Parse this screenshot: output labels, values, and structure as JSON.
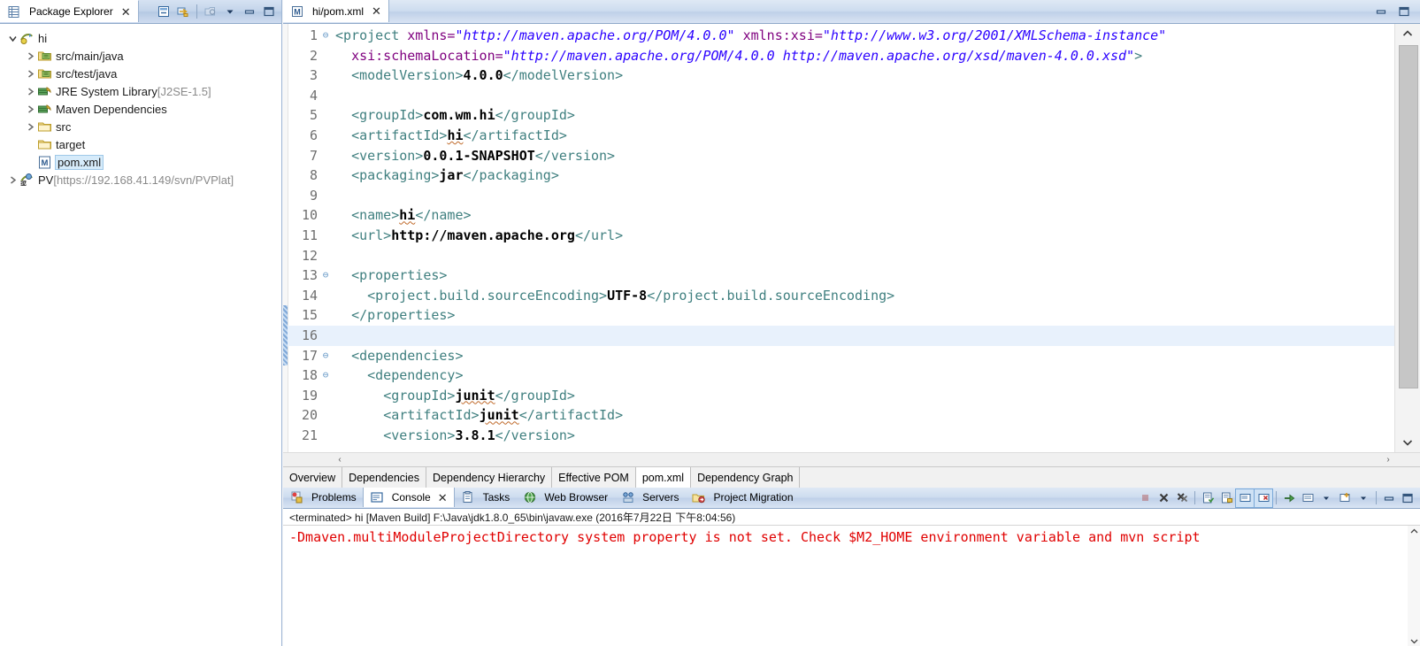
{
  "explorer": {
    "tab_label": "Package Explorer",
    "close_icon": "✕",
    "toolbar": [
      {
        "name": "collapse-all-icon",
        "title": "Collapse All"
      },
      {
        "name": "link-with-editor-icon",
        "title": "Link with Editor"
      },
      {
        "name": "view-menu-focus-icon",
        "title": "Focus On"
      },
      {
        "name": "chevron-down-icon",
        "title": "View Menu"
      },
      {
        "name": "minimize-icon",
        "title": "Minimize"
      },
      {
        "name": "maximize-icon",
        "title": "Maximize"
      }
    ],
    "tree": [
      {
        "label": "hi",
        "indent": 0,
        "icon": "maven-project-icon",
        "twisty": "expanded",
        "selected": false,
        "suffix": ""
      },
      {
        "label": "src/main/java",
        "indent": 1,
        "icon": "source-folder-icon",
        "twisty": "collapsed",
        "selected": false,
        "suffix": ""
      },
      {
        "label": "src/test/java",
        "indent": 1,
        "icon": "source-folder-icon",
        "twisty": "collapsed",
        "selected": false,
        "suffix": ""
      },
      {
        "label": "JRE System Library",
        "indent": 1,
        "icon": "library-icon",
        "twisty": "collapsed",
        "selected": false,
        "suffix": "[J2SE-1.5]"
      },
      {
        "label": "Maven Dependencies",
        "indent": 1,
        "icon": "library-icon",
        "twisty": "collapsed",
        "selected": false,
        "suffix": ""
      },
      {
        "label": "src",
        "indent": 1,
        "icon": "folder-icon",
        "twisty": "collapsed",
        "selected": false,
        "suffix": ""
      },
      {
        "label": "target",
        "indent": 1,
        "icon": "folder-icon",
        "twisty": "none",
        "selected": false,
        "suffix": ""
      },
      {
        "label": "pom.xml",
        "indent": 1,
        "icon": "maven-pom-icon",
        "twisty": "none",
        "selected": true,
        "suffix": ""
      },
      {
        "label": "PV",
        "indent": 0,
        "icon": "svn-project-icon",
        "twisty": "collapsed",
        "selected": false,
        "suffix": "[https://192.168.41.149/svn/PVPlat]"
      }
    ]
  },
  "editor": {
    "tab_label": "hi/pom.xml",
    "tab_icon": "maven-pom-icon",
    "close_icon": "✕",
    "minimize_icon": "minimize",
    "maximize_icon": "maximize",
    "scroll_up_icon": "︿",
    "scroll_down_icon": "﹀",
    "hscroll_left_icon": "‹",
    "hscroll_right_icon": "›",
    "current_line": 16,
    "change_bar_lines": [
      15,
      16,
      17
    ],
    "subtabs": [
      {
        "label": "Overview",
        "active": false
      },
      {
        "label": "Dependencies",
        "active": false
      },
      {
        "label": "Dependency Hierarchy",
        "active": false
      },
      {
        "label": "Effective POM",
        "active": false
      },
      {
        "label": "pom.xml",
        "active": true
      },
      {
        "label": "Dependency Graph",
        "active": false
      }
    ],
    "lines": [
      {
        "n": 1,
        "fold": true,
        "segs": [
          {
            "t": "tag",
            "s": "<project "
          },
          {
            "t": "attr",
            "s": "xmlns="
          },
          {
            "t": "val",
            "s": "\"http://maven.apache.org/POM/4.0.0\""
          },
          {
            "t": "tag",
            "s": " "
          },
          {
            "t": "attr",
            "s": "xmlns:xsi="
          },
          {
            "t": "val",
            "s": "\"http://www.w3.org/2001/XMLSchema-instance\""
          }
        ]
      },
      {
        "n": 2,
        "fold": false,
        "segs": [
          {
            "t": "plain",
            "s": "  "
          },
          {
            "t": "attr",
            "s": "xsi:schemaLocation="
          },
          {
            "t": "val",
            "s": "\"http://maven.apache.org/POM/4.0.0 http://maven.apache.org/xsd/maven-4.0.0.xsd\""
          },
          {
            "t": "tag",
            "s": ">"
          }
        ]
      },
      {
        "n": 3,
        "fold": false,
        "segs": [
          {
            "t": "plain",
            "s": "  "
          },
          {
            "t": "tag",
            "s": "<modelVersion>"
          },
          {
            "t": "txt",
            "s": "4.0.0"
          },
          {
            "t": "tag",
            "s": "</modelVersion>"
          }
        ]
      },
      {
        "n": 4,
        "fold": false,
        "segs": []
      },
      {
        "n": 5,
        "fold": false,
        "segs": [
          {
            "t": "plain",
            "s": "  "
          },
          {
            "t": "tag",
            "s": "<groupId>"
          },
          {
            "t": "txt",
            "s": "com.wm.hi"
          },
          {
            "t": "tag",
            "s": "</groupId>"
          }
        ]
      },
      {
        "n": 6,
        "fold": false,
        "segs": [
          {
            "t": "plain",
            "s": "  "
          },
          {
            "t": "tag",
            "s": "<artifactId>"
          },
          {
            "t": "txtsp",
            "s": "hi"
          },
          {
            "t": "tag",
            "s": "</artifactId>"
          }
        ]
      },
      {
        "n": 7,
        "fold": false,
        "segs": [
          {
            "t": "plain",
            "s": "  "
          },
          {
            "t": "tag",
            "s": "<version>"
          },
          {
            "t": "txt",
            "s": "0.0.1-SNAPSHOT"
          },
          {
            "t": "tag",
            "s": "</version>"
          }
        ]
      },
      {
        "n": 8,
        "fold": false,
        "segs": [
          {
            "t": "plain",
            "s": "  "
          },
          {
            "t": "tag",
            "s": "<packaging>"
          },
          {
            "t": "txt",
            "s": "jar"
          },
          {
            "t": "tag",
            "s": "</packaging>"
          }
        ]
      },
      {
        "n": 9,
        "fold": false,
        "segs": []
      },
      {
        "n": 10,
        "fold": false,
        "segs": [
          {
            "t": "plain",
            "s": "  "
          },
          {
            "t": "tag",
            "s": "<name>"
          },
          {
            "t": "txtsp",
            "s": "hi"
          },
          {
            "t": "tag",
            "s": "</name>"
          }
        ]
      },
      {
        "n": 11,
        "fold": false,
        "segs": [
          {
            "t": "plain",
            "s": "  "
          },
          {
            "t": "tag",
            "s": "<url>"
          },
          {
            "t": "txt",
            "s": "http://maven.apache.org"
          },
          {
            "t": "tag",
            "s": "</url>"
          }
        ]
      },
      {
        "n": 12,
        "fold": false,
        "segs": []
      },
      {
        "n": 13,
        "fold": true,
        "segs": [
          {
            "t": "plain",
            "s": "  "
          },
          {
            "t": "tag",
            "s": "<properties>"
          }
        ]
      },
      {
        "n": 14,
        "fold": false,
        "segs": [
          {
            "t": "plain",
            "s": "    "
          },
          {
            "t": "tag",
            "s": "<project.build.sourceEncoding>"
          },
          {
            "t": "txt",
            "s": "UTF-8"
          },
          {
            "t": "tag",
            "s": "</project.build.sourceEncoding>"
          }
        ]
      },
      {
        "n": 15,
        "fold": false,
        "segs": [
          {
            "t": "plain",
            "s": "  "
          },
          {
            "t": "tag",
            "s": "</properties>"
          }
        ]
      },
      {
        "n": 16,
        "fold": false,
        "segs": []
      },
      {
        "n": 17,
        "fold": true,
        "segs": [
          {
            "t": "plain",
            "s": "  "
          },
          {
            "t": "tag",
            "s": "<dependencies>"
          }
        ]
      },
      {
        "n": 18,
        "fold": true,
        "segs": [
          {
            "t": "plain",
            "s": "    "
          },
          {
            "t": "tag",
            "s": "<dependency>"
          }
        ]
      },
      {
        "n": 19,
        "fold": false,
        "segs": [
          {
            "t": "plain",
            "s": "      "
          },
          {
            "t": "tag",
            "s": "<groupId>"
          },
          {
            "t": "txtsp",
            "s": "junit"
          },
          {
            "t": "tag",
            "s": "</groupId>"
          }
        ]
      },
      {
        "n": 20,
        "fold": false,
        "segs": [
          {
            "t": "plain",
            "s": "      "
          },
          {
            "t": "tag",
            "s": "<artifactId>"
          },
          {
            "t": "txtsp",
            "s": "junit"
          },
          {
            "t": "tag",
            "s": "</artifactId>"
          }
        ]
      },
      {
        "n": 21,
        "fold": false,
        "segs": [
          {
            "t": "plain",
            "s": "      "
          },
          {
            "t": "tag",
            "s": "<version>"
          },
          {
            "t": "txt",
            "s": "3.8.1"
          },
          {
            "t": "tag",
            "s": "</version>"
          }
        ]
      }
    ]
  },
  "console": {
    "tabs": [
      {
        "label": "Problems",
        "icon": "problems-icon",
        "active": false,
        "closable": false
      },
      {
        "label": "Console",
        "icon": "console-icon",
        "active": true,
        "closable": true
      },
      {
        "label": "Tasks",
        "icon": "tasks-icon",
        "active": false,
        "closable": false
      },
      {
        "label": "Web Browser",
        "icon": "web-browser-icon",
        "active": false,
        "closable": false
      },
      {
        "label": "Servers",
        "icon": "servers-icon",
        "active": false,
        "closable": false
      },
      {
        "label": "Project Migration",
        "icon": "project-migration-icon",
        "active": false,
        "closable": false
      }
    ],
    "close_icon": "✕",
    "toolbar": [
      {
        "name": "terminate-icon",
        "title": "Terminate"
      },
      {
        "name": "remove-launch-icon",
        "title": "Remove Launch"
      },
      {
        "name": "remove-all-terminated-icon",
        "title": "Remove All Terminated Launches"
      },
      {
        "name": "clear-console-icon",
        "title": "Clear Console"
      },
      {
        "name": "scroll-lock-icon",
        "title": "Scroll Lock"
      },
      {
        "name": "show-console-icon",
        "title": "Show Console When Output Changes"
      },
      {
        "name": "close-console-icon",
        "title": "Close Console"
      },
      {
        "name": "pin-console-icon",
        "title": "Pin Console"
      },
      {
        "name": "display-selected-console-icon",
        "title": "Display Selected Console"
      },
      {
        "name": "display-console-dropdown-icon",
        "title": "Display Console Menu"
      },
      {
        "name": "open-console-icon",
        "title": "Open Console"
      },
      {
        "name": "open-console-dropdown-icon",
        "title": "Open Console Menu"
      },
      {
        "name": "minimize-icon",
        "title": "Minimize"
      },
      {
        "name": "maximize-icon",
        "title": "Maximize"
      }
    ],
    "status_line": "<terminated> hi [Maven Build] F:\\Java\\jdk1.8.0_65\\bin\\javaw.exe (2016年7月22日 下午8:04:56)",
    "output_line": "-Dmaven.multiModuleProjectDirectory system property is not set. Check $M2_HOME environment variable and mvn script",
    "output_color": "#e00000",
    "scroll_up_icon": "︿",
    "scroll_down_icon": "﹀"
  }
}
